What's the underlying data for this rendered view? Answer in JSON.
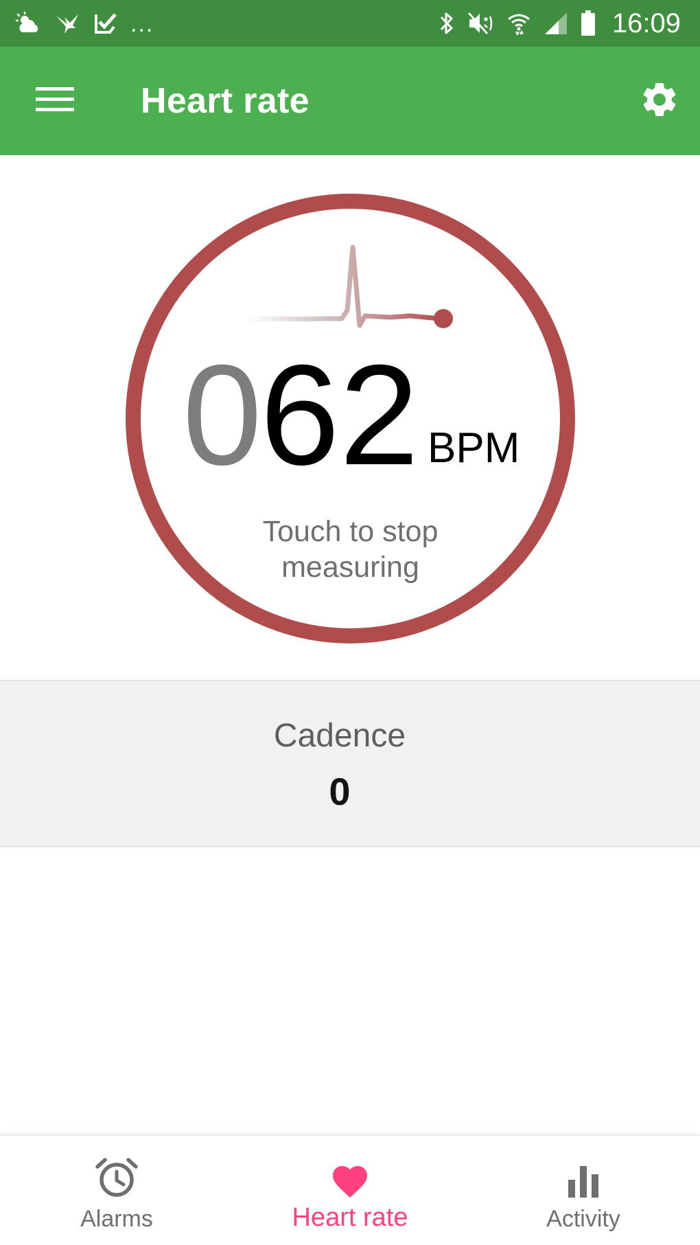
{
  "status_bar": {
    "time": "16:09",
    "overflow": "...",
    "left_icons": [
      "weather-icon",
      "bird-icon",
      "check-icon"
    ],
    "right_icons": [
      "bluetooth-icon",
      "mute-icon",
      "wifi-icon",
      "signal-icon",
      "battery-icon"
    ]
  },
  "app_bar": {
    "title": "Heart rate",
    "menu_icon": "menu-icon",
    "settings_icon": "gear-icon",
    "color": "#4caf50"
  },
  "heart_rate": {
    "leading_digit": "0",
    "value": "62",
    "unit": "BPM",
    "hint": "Touch to stop\nmeasuring",
    "ring_color": "#b04c4c"
  },
  "cadence": {
    "label": "Cadence",
    "value": "0"
  },
  "bottom_nav": {
    "items": [
      {
        "label": "Alarms",
        "icon": "alarm-clock-icon",
        "active": false
      },
      {
        "label": "Heart rate",
        "icon": "heart-icon",
        "active": true
      },
      {
        "label": "Activity",
        "icon": "bar-chart-icon",
        "active": false
      }
    ],
    "active_color": "#ff4081",
    "inactive_color": "#6f6f6f"
  }
}
